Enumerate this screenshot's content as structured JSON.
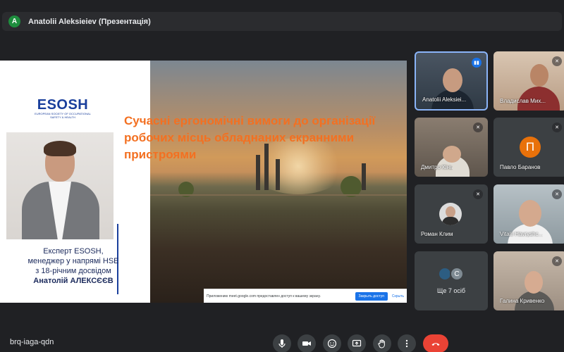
{
  "presenter_bar": {
    "avatar_letter": "A",
    "title": "Anatolii Aleksieiev (Презентація)"
  },
  "slide": {
    "logo_word": "ESOSH",
    "logo_subtitle": "European Society of Occupational Safety & Health",
    "title": "Сучасні ергономічні вимоги до організації робочих місць обладнаних екранними пристроями",
    "caption_lines": [
      "Експерт ESOSH,",
      "менеджер у напрямі HSE",
      "з 18-річним досвідом",
      "Анатолій АЛЕКСЄЄВ"
    ],
    "title_color": "#f37021"
  },
  "share_banner": {
    "text": "Приложению meet.google.com предоставлен доступ к вашему экрану.",
    "allow_label": "Закрыть доступ",
    "cancel_label": "Скрыть"
  },
  "participants": [
    {
      "name": "Anatolii Aleksiei...",
      "audio": "speaking"
    },
    {
      "name": "Владислав Мих...",
      "audio": "muted"
    },
    {
      "name": "Дмитро Кінь",
      "audio": "muted"
    },
    {
      "name": "Павло Баранов",
      "audio": "muted",
      "avatar_letter": "П",
      "avatar_color": "#e8710a"
    },
    {
      "name": "Роман Клим",
      "audio": "muted"
    },
    {
      "name": "Vitalii Havryshc...",
      "audio": "muted"
    },
    {
      "more_label": "Ще 7 осіб",
      "avatar_letter": "C"
    },
    {
      "name": "Галина Кривенко",
      "audio": "muted"
    }
  ],
  "bottom_bar": {
    "meeting_code": "brq-iaga-qdn",
    "controls": [
      "mic-icon",
      "camera-icon",
      "emoji-icon",
      "present-icon",
      "raise-hand-icon",
      "more-vert-icon",
      "hangup-icon"
    ]
  }
}
